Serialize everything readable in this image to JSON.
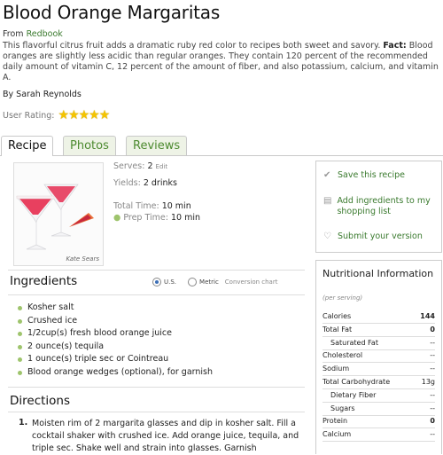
{
  "recipe": {
    "title": "Blood Orange Margaritas",
    "from_label": "From",
    "source": "Redbook",
    "description": "This flavorful citrus fruit adds a dramatic ruby red color to recipes both sweet and savory.",
    "fact_label": "Fact:",
    "fact": "Blood oranges are slightly less acidic than regular oranges. They contain 120 percent of the recommended daily amount of vitamin C, 12 percent of the amount of fiber, and also potassium, calcium, and vitamin A.",
    "byline": "By Sarah Reynolds",
    "rating_label": "User Rating:",
    "rating_value": 5,
    "rating_max": 5,
    "stars": "★★★★★"
  },
  "tabs": [
    {
      "label": "Recipe",
      "active": true
    },
    {
      "label": "Photos",
      "active": false
    },
    {
      "label": "Reviews",
      "active": false
    }
  ],
  "photo": {
    "caption": "Kate Sears"
  },
  "meta": {
    "serves_label": "Serves:",
    "serves_value": "2",
    "edit_label": "Edit",
    "yields_label": "Yields:",
    "yields_value": "2 drinks",
    "total_label": "Total Time:",
    "total_value": "10 min",
    "prep_label": "Prep Time:",
    "prep_value": "10 min"
  },
  "actions": {
    "save": "Save this recipe",
    "add": "Add ingredients to my shopping list",
    "submit": "Submit your version"
  },
  "ingredients": {
    "title": "Ingredients",
    "us_label": "U.S.",
    "metric_label": "Metric",
    "convert_label": "Conversion chart",
    "selected_unit": "U.S.",
    "items": [
      "Kosher salt",
      "Crushed ice",
      "1/2cup(s) fresh blood orange juice",
      "2 ounce(s) tequila",
      "1 ounce(s) triple sec or Cointreau",
      "Blood orange wedges (optional), for garnish"
    ]
  },
  "directions": {
    "title": "Directions",
    "steps": [
      {
        "num": "1.",
        "text": "Moisten rim of 2 margarita glasses and dip in kosher salt. Fill a cocktail shaker with crushed ice. Add orange juice, tequila, and triple sec. Shake well and strain into glasses. Garnish"
      }
    ]
  },
  "nutrition": {
    "title": "Nutritional Information",
    "serving_note": "(per serving)",
    "rows": [
      {
        "label": "Calories",
        "value": "144",
        "indent": false,
        "bold": true
      },
      {
        "label": "Total Fat",
        "value": "0",
        "indent": false,
        "bold": true
      },
      {
        "label": "Saturated Fat",
        "value": "--",
        "indent": true,
        "bold": false
      },
      {
        "label": "Cholesterol",
        "value": "--",
        "indent": false,
        "bold": false
      },
      {
        "label": "Sodium",
        "value": "--",
        "indent": false,
        "bold": false
      },
      {
        "label": "Total Carbohydrate",
        "value": "13g",
        "indent": false,
        "bold": false
      },
      {
        "label": "Dietary Fiber",
        "value": "--",
        "indent": true,
        "bold": false
      },
      {
        "label": "Sugars",
        "value": "--",
        "indent": true,
        "bold": false
      },
      {
        "label": "Protein",
        "value": "0",
        "indent": false,
        "bold": true
      },
      {
        "label": "Calcium",
        "value": "--",
        "indent": false,
        "bold": false
      }
    ]
  },
  "colors": {
    "link": "#3a7a2e",
    "star": "#f4c400",
    "bullet": "#9ec46c",
    "tab_bg": "#eef3e6"
  }
}
